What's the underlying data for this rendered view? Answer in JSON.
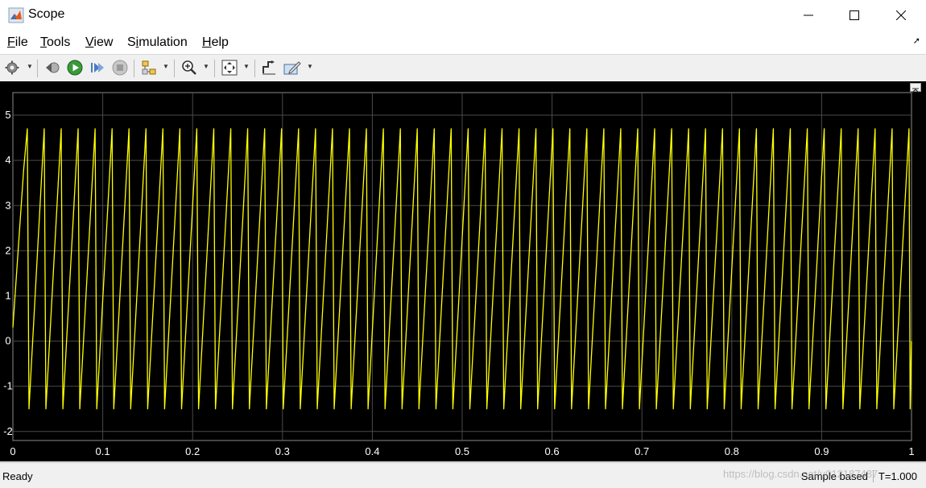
{
  "window": {
    "title": "Scope"
  },
  "menu": {
    "items": [
      {
        "pre": "",
        "u": "F",
        "post": "ile"
      },
      {
        "pre": "",
        "u": "T",
        "post": "ools"
      },
      {
        "pre": "",
        "u": "V",
        "post": "iew"
      },
      {
        "pre": "S",
        "u": "i",
        "post": "mulation"
      },
      {
        "pre": "",
        "u": "H",
        "post": "elp"
      }
    ]
  },
  "toolbar": {
    "icons": [
      "settings-icon",
      "step-back-icon",
      "run-icon",
      "step-forward-icon",
      "stop-icon",
      "highlight-block-icon",
      "zoom-in-icon",
      "fit-view-icon",
      "cursor-measurements-icon",
      "signal-statistics-icon"
    ]
  },
  "status": {
    "ready": "Ready",
    "mode": "Sample based",
    "time": "T=1.000"
  },
  "watermark": "https://blog.csdn.net/u012187487",
  "colors": {
    "trace": "#ffff00",
    "background": "#000000",
    "grid": "#4a4a4a",
    "axis_text": "#ffffff"
  },
  "chart_data": {
    "type": "line",
    "title": "",
    "xlabel": "",
    "ylabel": "",
    "xlim": [
      0,
      1
    ],
    "ylim": [
      -2.2,
      5.5
    ],
    "xticks": [
      "0",
      "0.1",
      "0.2",
      "0.3",
      "0.4",
      "0.5",
      "0.6",
      "0.7",
      "0.8",
      "0.9",
      "1"
    ],
    "yticks": [
      "-2",
      "-1",
      "0",
      "1",
      "2",
      "3",
      "4",
      "5"
    ],
    "grid": true,
    "series": [
      {
        "name": "",
        "color": "#ffff00",
        "shape": "sawtooth",
        "period": 0.01887,
        "min": -1.5,
        "max": 4.7,
        "start_value": 0.3,
        "end_value": 0
      }
    ]
  }
}
